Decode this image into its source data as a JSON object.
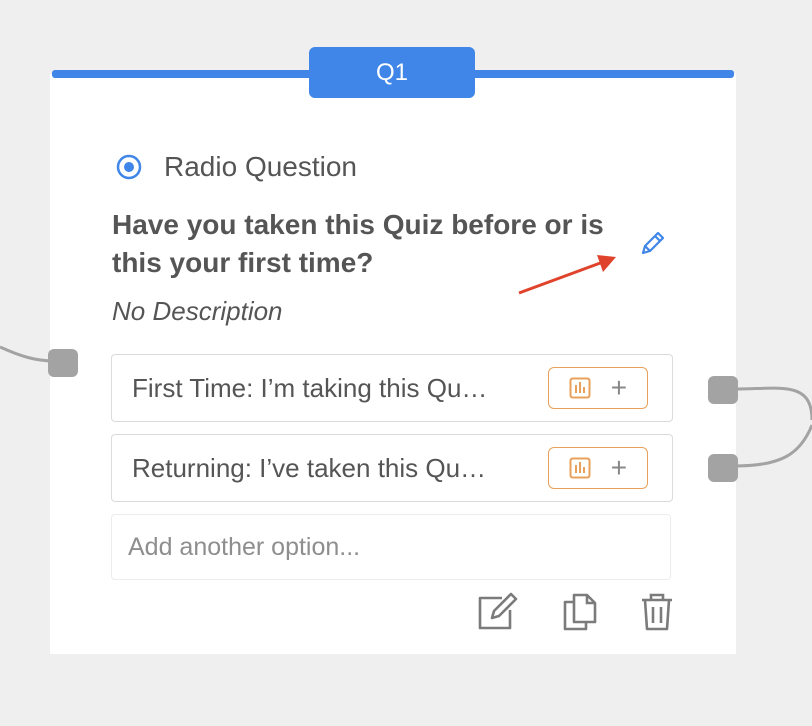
{
  "card": {
    "tab_label": "Q1",
    "type_label": "Radio Question",
    "type_icon": "radio-button-icon",
    "question_text": "Have you taken this Quiz before or is this your first time?",
    "description": "No Description"
  },
  "options": [
    {
      "label": "First Time: I’m taking this Qu…",
      "icons": [
        "chart-icon",
        "plus-icon"
      ],
      "plus": "+"
    },
    {
      "label": "Returning: I’ve taken this Qu…",
      "icons": [
        "chart-icon",
        "plus-icon"
      ],
      "plus": "+"
    }
  ],
  "add_option": {
    "placeholder": "Add another option..."
  },
  "toolbar": [
    "edit-icon",
    "duplicate-icon",
    "delete-icon"
  ],
  "colors": {
    "accent": "#3f86e8",
    "option_button_border": "#e8a15a",
    "annotation_arrow": "#e0432b",
    "text": "#555555"
  }
}
